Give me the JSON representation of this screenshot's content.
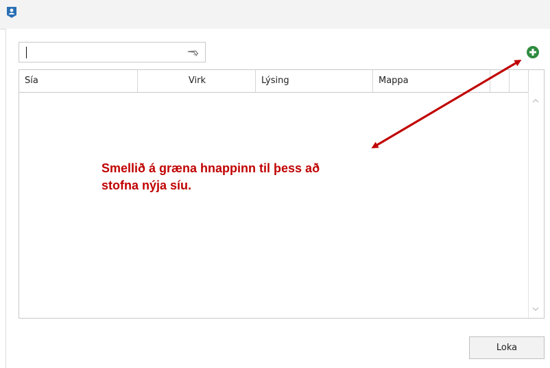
{
  "search": {
    "value": "",
    "placeholder": ""
  },
  "grid": {
    "columns": [
      "Sía",
      "Virk",
      "Lýsing",
      "Mappa",
      "",
      ""
    ],
    "rows": []
  },
  "annotation": {
    "line1": "Smellið á græna hnappinn til þess að",
    "line2": "stofna nýja síu."
  },
  "footer": {
    "close_label": "Loka"
  },
  "icons": {
    "app": "user-badge-icon",
    "filter": "filter-funnel-icon",
    "add": "plus-circle-icon",
    "scroll_up": "chevron-up-icon",
    "scroll_down": "chevron-down-icon"
  },
  "colors": {
    "accent_green": "#2e8b3e",
    "annotation_red": "#c00000"
  }
}
